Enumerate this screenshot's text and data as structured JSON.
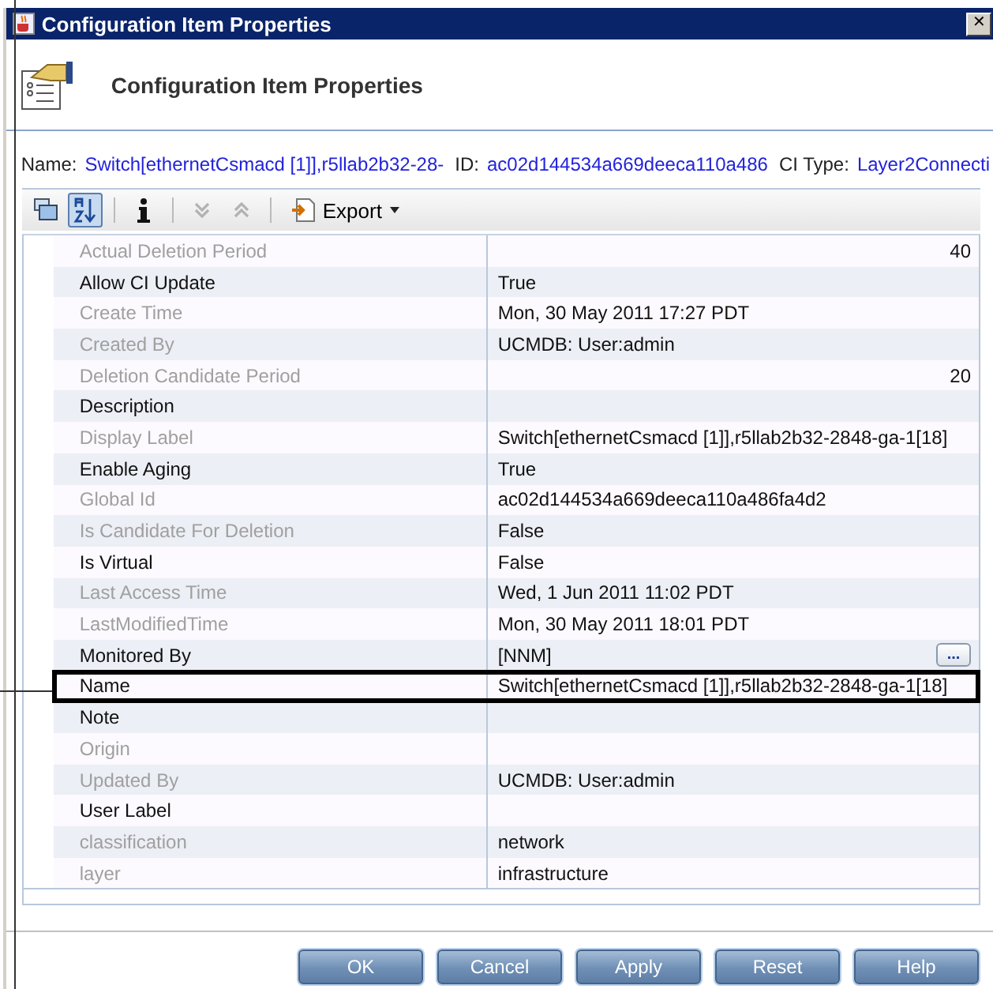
{
  "window": {
    "title": "Configuration Item Properties",
    "close": "✕"
  },
  "header": {
    "title": "Configuration Item Properties"
  },
  "info": [
    {
      "label": "Name:",
      "value": "Switch[ethernetCsmacd [1]],r5llab2b32-28-"
    },
    {
      "label": "ID:",
      "value": "ac02d144534a669deeca110a486"
    },
    {
      "label": "CI Type:",
      "value": "Layer2Connecti"
    }
  ],
  "toolbar": [
    {
      "kind": "categorized",
      "selected": false,
      "disabled": false
    },
    {
      "kind": "sort",
      "selected": true,
      "disabled": false
    },
    {
      "kind": "separator"
    },
    {
      "kind": "info",
      "selected": false,
      "disabled": false
    },
    {
      "kind": "separator"
    },
    {
      "kind": "down",
      "selected": false,
      "disabled": true
    },
    {
      "kind": "up",
      "selected": false,
      "disabled": true
    },
    {
      "kind": "separator"
    },
    {
      "kind": "export",
      "selected": false,
      "disabled": false,
      "label": "Export"
    }
  ],
  "rows": [
    {
      "name": "Actual Deletion Period",
      "value": "40",
      "kind": "number",
      "editable": false,
      "highlighted": false
    },
    {
      "name": "Allow CI Update",
      "value": "True",
      "kind": "text",
      "editable": true,
      "highlighted": false
    },
    {
      "name": "Create Time",
      "value": "Mon, 30 May 2011 17:27 PDT",
      "kind": "text",
      "editable": false,
      "highlighted": false
    },
    {
      "name": "Created By",
      "value": "UCMDB: User:admin",
      "kind": "text",
      "editable": false,
      "highlighted": false
    },
    {
      "name": "Deletion Candidate Period",
      "value": "20",
      "kind": "number",
      "editable": false,
      "highlighted": false
    },
    {
      "name": "Description",
      "kind": "text",
      "editable": true,
      "highlighted": false
    },
    {
      "name": "Display Label",
      "value": "Switch[ethernetCsmacd [1]],r5llab2b32-2848-ga-1[18]",
      "kind": "text",
      "editable": false,
      "highlighted": false
    },
    {
      "name": "Enable Aging",
      "value": "True",
      "kind": "text",
      "editable": true,
      "highlighted": false
    },
    {
      "name": "Global Id",
      "value": "ac02d144534a669deeca110a486fa4d2",
      "kind": "text",
      "editable": false,
      "highlighted": false
    },
    {
      "name": "Is Candidate For Deletion",
      "value": "False",
      "kind": "text",
      "editable": false,
      "highlighted": false
    },
    {
      "name": "Is Virtual",
      "value": "False",
      "kind": "text",
      "editable": true,
      "highlighted": false
    },
    {
      "name": "Last Access Time",
      "value": "Wed, 1 Jun 2011 11:02 PDT",
      "kind": "text",
      "editable": false,
      "highlighted": false
    },
    {
      "name": "LastModifiedTime",
      "value": "Mon, 30 May 2011 18:01 PDT",
      "kind": "text",
      "editable": false,
      "highlighted": false
    },
    {
      "name": "Monitored By",
      "value": "[NNM]",
      "kind": "browse",
      "browse": "...",
      "editable": true,
      "highlighted": false
    },
    {
      "name": "Name",
      "value": "Switch[ethernetCsmacd [1]],r5llab2b32-2848-ga-1[18]",
      "kind": "text",
      "editable": true,
      "highlighted": true
    },
    {
      "name": "Note",
      "kind": "text",
      "editable": true,
      "highlighted": false
    },
    {
      "name": "Origin",
      "kind": "text",
      "editable": false,
      "highlighted": false
    },
    {
      "name": "Updated By",
      "value": "UCMDB: User:admin",
      "kind": "text",
      "editable": false,
      "highlighted": false
    },
    {
      "name": "User Label",
      "kind": "text",
      "editable": true,
      "highlighted": false
    },
    {
      "name": "classification",
      "value": "network",
      "kind": "text",
      "editable": false,
      "highlighted": false
    },
    {
      "name": "layer",
      "value": "infrastructure",
      "kind": "text",
      "editable": false,
      "highlighted": false
    }
  ],
  "buttons": [
    "OK",
    "Cancel",
    "Apply",
    "Reset",
    "Help"
  ]
}
